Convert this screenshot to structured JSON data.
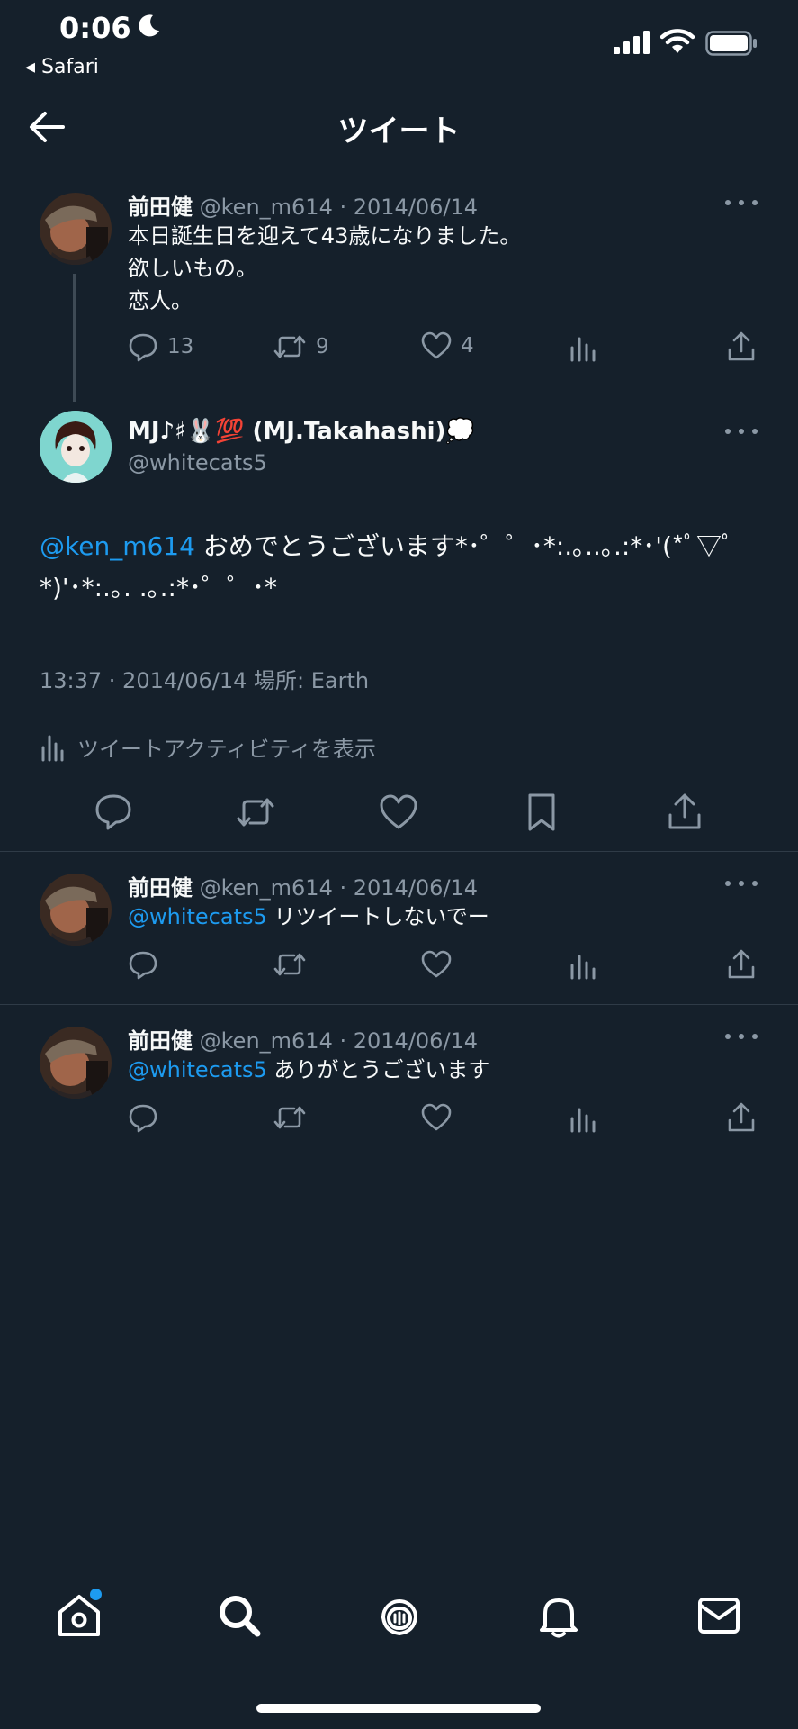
{
  "status_bar": {
    "time": "0:06",
    "back_app": "◂ Safari"
  },
  "header": {
    "title": "ツイート"
  },
  "parent_tweet": {
    "name": "前田健",
    "handle_date": "@ken_m614 · 2014/06/14",
    "lines": [
      "本日誕生日を迎えて43歳になりました。",
      "欲しいもの。",
      "恋人。"
    ],
    "reply_count": "13",
    "retweet_count": "9",
    "like_count": "4"
  },
  "main_tweet": {
    "name": "MJ♪♯🐰💯 (MJ.Takahashi)💭",
    "handle": "@whitecats5",
    "mention": "@ken_m614",
    "text_line1": " おめでとうございます*･゜゜･*:.｡..｡.:*･'(*ﾟ▽ﾟ",
    "text_line2": "*)'･*:.｡. .｡.:*･゜゜･*",
    "meta": "13:37 · 2014/06/14 場所: Earth",
    "activity_label": "ツイートアクティビティを表示"
  },
  "replies": [
    {
      "name": "前田健",
      "handle_date": "@ken_m614 · 2014/06/14",
      "mention": "@whitecats5",
      "text": " リツイートしないでー"
    },
    {
      "name": "前田健",
      "handle_date": "@ken_m614 · 2014/06/14",
      "mention": "@whitecats5",
      "text": " ありがとうございます"
    }
  ],
  "tab_bar": {
    "items": [
      "home-icon",
      "search-icon",
      "spaces-icon",
      "notifications-icon",
      "messages-icon"
    ],
    "home_has_badge": true
  },
  "colors": {
    "background": "#15202b",
    "link": "#1d9bf0",
    "secondary_text": "#8b98a5",
    "divider": "#2f3b47"
  }
}
